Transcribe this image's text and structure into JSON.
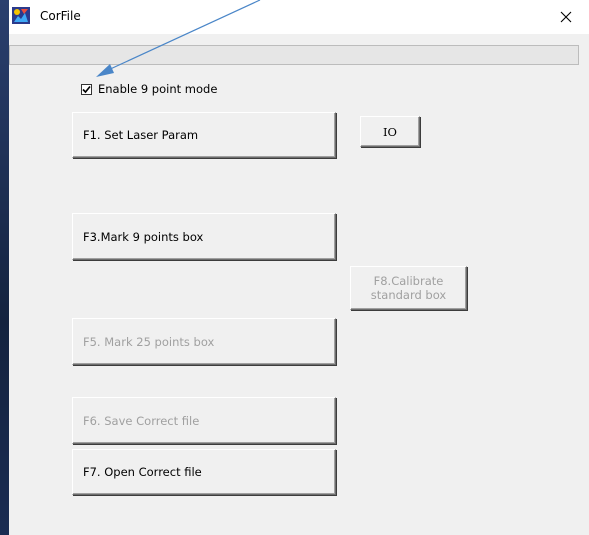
{
  "window": {
    "title": "CorFile",
    "close_icon": "close-icon",
    "app_icon": "corfile-app-icon"
  },
  "progress": {
    "value": 0
  },
  "options": {
    "enable_9_point_label": "Enable 9 point mode",
    "enable_9_point_checked": true
  },
  "buttons": {
    "f1": {
      "label": "F1. Set Laser Param",
      "enabled": true
    },
    "io": {
      "label": "IO",
      "enabled": true
    },
    "f3": {
      "label": "F3.Mark 9 points box",
      "enabled": true
    },
    "f8": {
      "label": "F8.Calibrate\nstandard box",
      "enabled": false
    },
    "f5": {
      "label": "F5. Mark 25 points box",
      "enabled": false
    },
    "f6": {
      "label": "F6. Save Correct file",
      "enabled": false
    },
    "f7": {
      "label": "F7. Open Correct file",
      "enabled": true
    }
  },
  "annotation": {
    "arrow_color": "#4a86c8",
    "icon": "annotation-arrow-icon"
  }
}
